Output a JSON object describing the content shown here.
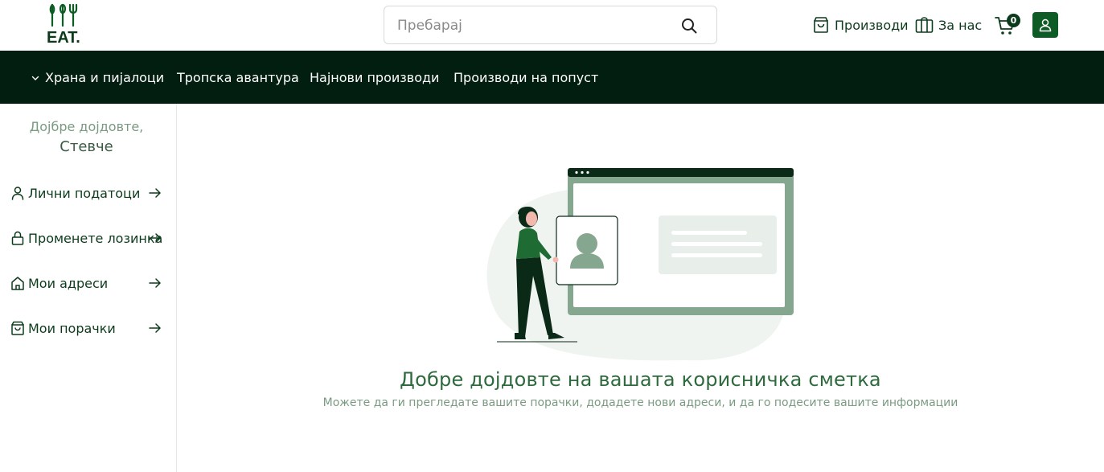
{
  "header": {
    "logo_text": "EAT.",
    "search": {
      "placeholder": "Пребарај"
    },
    "links": [
      {
        "label": "Производи",
        "icon": "shopping-bag-icon"
      },
      {
        "label": "За нас",
        "icon": "gift-icon"
      }
    ],
    "cart_count": "0",
    "colors": {
      "accent": "#0d5c25",
      "dark": "#021e10"
    }
  },
  "categories": [
    {
      "label": "Храна и пијалоци",
      "has_dropdown": true
    },
    {
      "label": "Тропска авантура"
    },
    {
      "label": "Најнови производи"
    },
    {
      "label": "Производи на попуст"
    }
  ],
  "sidebar": {
    "welcome": "Дојбре дојдовте,",
    "username": "Стевче",
    "items": [
      {
        "label": "Лични податоци",
        "icon": "user-icon"
      },
      {
        "label": "Променете лозинка",
        "icon": "lock-icon"
      },
      {
        "label": "Мои адреси",
        "icon": "home-icon"
      },
      {
        "label": "Мои порачки",
        "icon": "shopping-bag-icon"
      }
    ]
  },
  "main": {
    "title": "Добре дојдовте на вашата корисничка сметка",
    "subtitle": "Можете да ги прегледате вашите порачки, додадете нови адреси, и да го подесите вашите информации"
  }
}
